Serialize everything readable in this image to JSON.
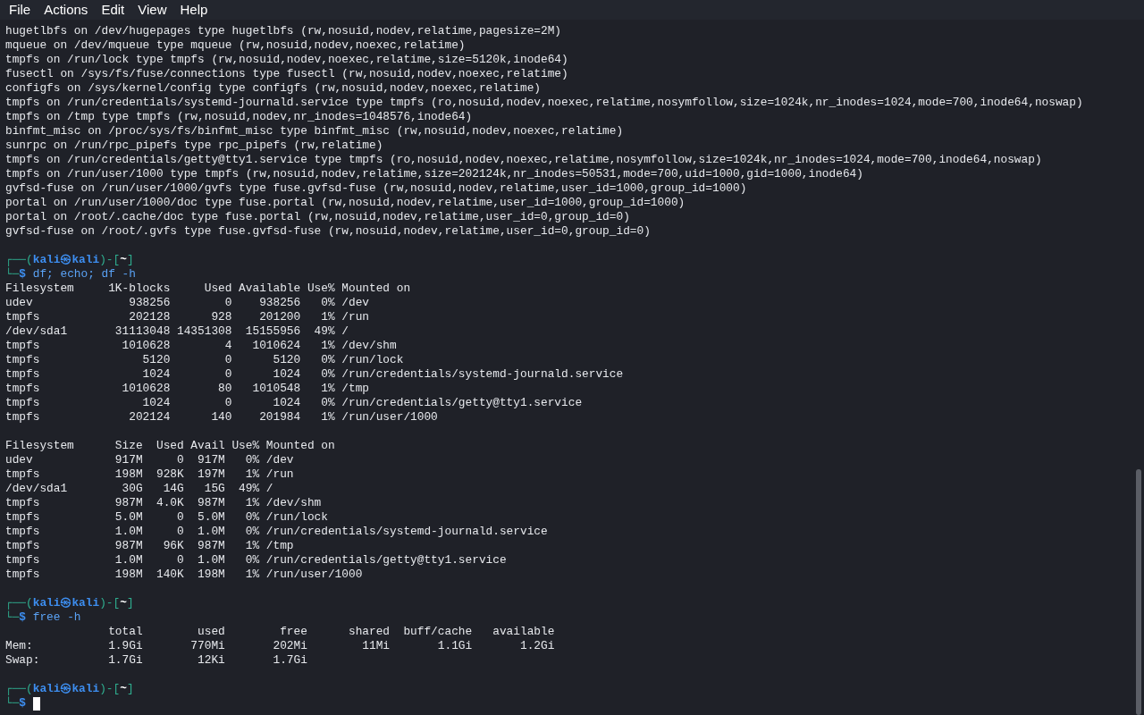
{
  "menu": [
    {
      "label": "File"
    },
    {
      "label": "Actions"
    },
    {
      "label": "Edit"
    },
    {
      "label": "View"
    },
    {
      "label": "Help"
    }
  ],
  "lines": [
    {
      "kind": "text",
      "text": "hugetlbfs on /dev/hugepages type hugetlbfs (rw,nosuid,nodev,relatime,pagesize=2M)"
    },
    {
      "kind": "text",
      "text": "mqueue on /dev/mqueue type mqueue (rw,nosuid,nodev,noexec,relatime)"
    },
    {
      "kind": "text",
      "text": "tmpfs on /run/lock type tmpfs (rw,nosuid,nodev,noexec,relatime,size=5120k,inode64)"
    },
    {
      "kind": "text",
      "text": "fusectl on /sys/fs/fuse/connections type fusectl (rw,nosuid,nodev,noexec,relatime)"
    },
    {
      "kind": "text",
      "text": "configfs on /sys/kernel/config type configfs (rw,nosuid,nodev,noexec,relatime)"
    },
    {
      "kind": "text",
      "text": "tmpfs on /run/credentials/systemd-journald.service type tmpfs (ro,nosuid,nodev,noexec,relatime,nosymfollow,size=1024k,nr_inodes=1024,mode=700,inode64,noswap)"
    },
    {
      "kind": "text",
      "text": "tmpfs on /tmp type tmpfs (rw,nosuid,nodev,nr_inodes=1048576,inode64)"
    },
    {
      "kind": "text",
      "text": "binfmt_misc on /proc/sys/fs/binfmt_misc type binfmt_misc (rw,nosuid,nodev,noexec,relatime)"
    },
    {
      "kind": "text",
      "text": "sunrpc on /run/rpc_pipefs type rpc_pipefs (rw,relatime)"
    },
    {
      "kind": "text",
      "text": "tmpfs on /run/credentials/getty@tty1.service type tmpfs (ro,nosuid,nodev,noexec,relatime,nosymfollow,size=1024k,nr_inodes=1024,mode=700,inode64,noswap)"
    },
    {
      "kind": "text",
      "text": "tmpfs on /run/user/1000 type tmpfs (rw,nosuid,nodev,relatime,size=202124k,nr_inodes=50531,mode=700,uid=1000,gid=1000,inode64)"
    },
    {
      "kind": "text",
      "text": "gvfsd-fuse on /run/user/1000/gvfs type fuse.gvfsd-fuse (rw,nosuid,nodev,relatime,user_id=1000,group_id=1000)"
    },
    {
      "kind": "text",
      "text": "portal on /run/user/1000/doc type fuse.portal (rw,nosuid,nodev,relatime,user_id=1000,group_id=1000)"
    },
    {
      "kind": "text",
      "text": "portal on /root/.cache/doc type fuse.portal (rw,nosuid,nodev,relatime,user_id=0,group_id=0)"
    },
    {
      "kind": "text",
      "text": "gvfsd-fuse on /root/.gvfs type fuse.gvfsd-fuse (rw,nosuid,nodev,relatime,user_id=0,group_id=0)"
    },
    {
      "kind": "blank"
    },
    {
      "kind": "prompt",
      "lead": "┌──(",
      "user_host": "kali㉿kali",
      "middle": ")-[",
      "dir": "~",
      "close": "]",
      "corner": "└─",
      "symbol": "$",
      "command": "df; echo; df -h"
    },
    {
      "kind": "text",
      "text": "Filesystem     1K-blocks     Used Available Use% Mounted on"
    },
    {
      "kind": "text",
      "text": "udev              938256        0    938256   0% /dev"
    },
    {
      "kind": "text",
      "text": "tmpfs             202128      928    201200   1% /run"
    },
    {
      "kind": "text",
      "text": "/dev/sda1       31113048 14351308  15155956  49% /"
    },
    {
      "kind": "text",
      "text": "tmpfs            1010628        4   1010624   1% /dev/shm"
    },
    {
      "kind": "text",
      "text": "tmpfs               5120        0      5120   0% /run/lock"
    },
    {
      "kind": "text",
      "text": "tmpfs               1024        0      1024   0% /run/credentials/systemd-journald.service"
    },
    {
      "kind": "text",
      "text": "tmpfs            1010628       80   1010548   1% /tmp"
    },
    {
      "kind": "text",
      "text": "tmpfs               1024        0      1024   0% /run/credentials/getty@tty1.service"
    },
    {
      "kind": "text",
      "text": "tmpfs             202124      140    201984   1% /run/user/1000"
    },
    {
      "kind": "blank"
    },
    {
      "kind": "text",
      "text": "Filesystem      Size  Used Avail Use% Mounted on"
    },
    {
      "kind": "text",
      "text": "udev            917M     0  917M   0% /dev"
    },
    {
      "kind": "text",
      "text": "tmpfs           198M  928K  197M   1% /run"
    },
    {
      "kind": "text",
      "text": "/dev/sda1        30G   14G   15G  49% /"
    },
    {
      "kind": "text",
      "text": "tmpfs           987M  4.0K  987M   1% /dev/shm"
    },
    {
      "kind": "text",
      "text": "tmpfs           5.0M     0  5.0M   0% /run/lock"
    },
    {
      "kind": "text",
      "text": "tmpfs           1.0M     0  1.0M   0% /run/credentials/systemd-journald.service"
    },
    {
      "kind": "text",
      "text": "tmpfs           987M   96K  987M   1% /tmp"
    },
    {
      "kind": "text",
      "text": "tmpfs           1.0M     0  1.0M   0% /run/credentials/getty@tty1.service"
    },
    {
      "kind": "text",
      "text": "tmpfs           198M  140K  198M   1% /run/user/1000"
    },
    {
      "kind": "blank"
    },
    {
      "kind": "prompt",
      "lead": "┌──(",
      "user_host": "kali㉿kali",
      "middle": ")-[",
      "dir": "~",
      "close": "]",
      "corner": "└─",
      "symbol": "$",
      "command": "free -h"
    },
    {
      "kind": "text",
      "text": "               total        used        free      shared  buff/cache   available"
    },
    {
      "kind": "text",
      "text": "Mem:           1.9Gi       770Mi       202Mi        11Mi       1.1Gi       1.2Gi"
    },
    {
      "kind": "text",
      "text": "Swap:          1.7Gi        12Ki       1.7Gi"
    },
    {
      "kind": "blank"
    },
    {
      "kind": "prompt",
      "lead": "┌──(",
      "user_host": "kali㉿kali",
      "middle": ")-[",
      "dir": "~",
      "close": "]",
      "corner": "└─",
      "symbol": "$",
      "cursor": true
    }
  ]
}
